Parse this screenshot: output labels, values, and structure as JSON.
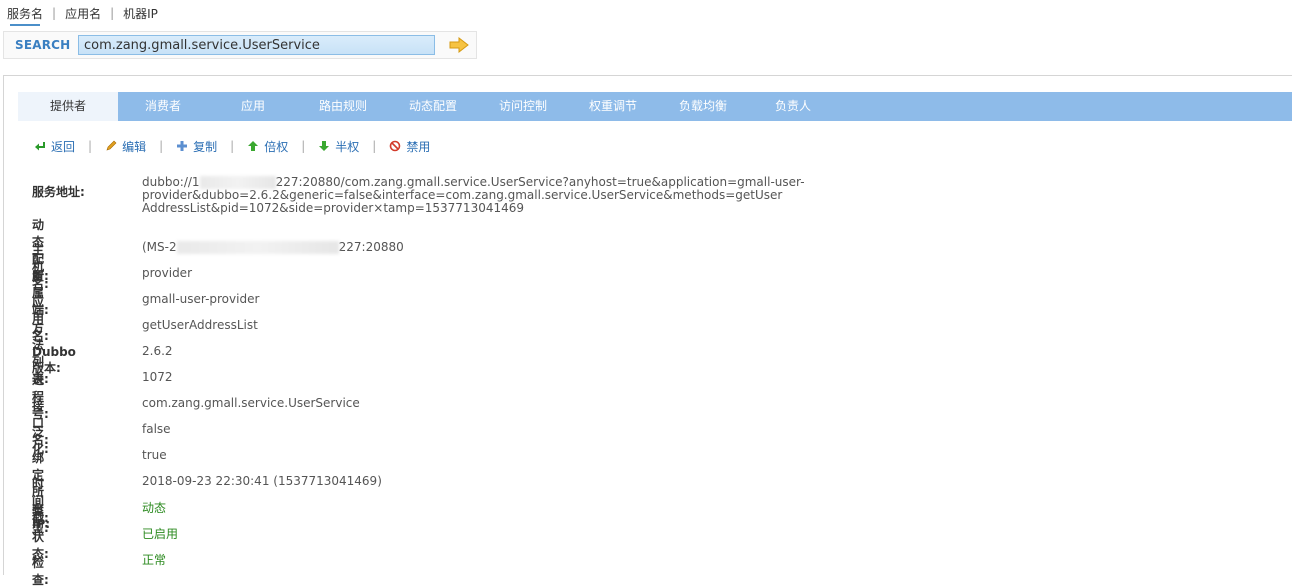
{
  "search_types": [
    {
      "label": "服务名",
      "active": true
    },
    {
      "label": "应用名",
      "active": false
    },
    {
      "label": "机器IP",
      "active": false
    }
  ],
  "search": {
    "label": "SEARCH",
    "value": "com.zang.gmall.service.UserService",
    "go_icon": "arrow-right-icon"
  },
  "tabs": [
    "提供者",
    "消费者",
    "应用",
    "路由规则",
    "动态配置",
    "访问控制",
    "权重调节",
    "负载均衡",
    "负责人"
  ],
  "actions": [
    {
      "label": "返回",
      "icon": "return-icon"
    },
    {
      "label": "编辑",
      "icon": "pencil-icon"
    },
    {
      "label": "复制",
      "icon": "plus-icon"
    },
    {
      "label": "倍权",
      "icon": "arrow-up-icon"
    },
    {
      "label": "半权",
      "icon": "arrow-down-icon"
    },
    {
      "label": "禁用",
      "icon": "ban-icon"
    }
  ],
  "details": {
    "address": {
      "label": "服务地址:",
      "prefix": "dubbo://1",
      "line1_rest": "227:20880/com.zang.gmall.service.UserService?anyhost=true&application=gmall-user-provider&dubbo=2.6.2&generic=false&interface=com.zang.gmall.service.UserService&methods=getUser",
      "line2": "AddressList&pid=1072&side=provider×tamp=1537713041469"
    },
    "dynamic_config": {
      "label": "动态配置:",
      "value": ""
    },
    "host": {
      "label": "主机名:",
      "prefix": "(MS-2",
      "suffix": "227:20880"
    },
    "side": {
      "label": "所属端:",
      "value": "provider"
    },
    "application": {
      "label": "应用名:",
      "value": "gmall-user-provider"
    },
    "methods": {
      "label": "方法列表:",
      "value": "getUserAddressList"
    },
    "dubbo_version": {
      "label": "Dubbo版本:",
      "value": "2.6.2"
    },
    "pid": {
      "label": "进程号:",
      "value": "1072"
    },
    "interface": {
      "label": "接口名:",
      "value": "com.zang.gmall.service.UserService"
    },
    "generic": {
      "label": "泛化:",
      "value": "false"
    },
    "anyhost": {
      "label": "绑定所有IP:",
      "value": "true"
    },
    "timestamp": {
      "label": "时间戳:",
      "value": "2018-09-23 22:30:41 (1537713041469)"
    },
    "type": {
      "label": "类型:",
      "value": "动态"
    },
    "status": {
      "label": "状态:",
      "value": "已启用"
    },
    "check": {
      "label": "检查:",
      "value": "正常"
    }
  },
  "colors": {
    "tabbar": "#8ebbe9",
    "link": "#2c6fb4",
    "green": "#2b8a1f"
  }
}
